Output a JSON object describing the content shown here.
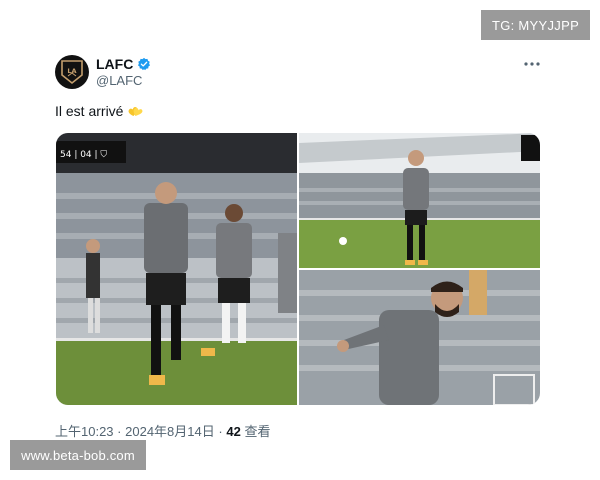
{
  "watermarks": {
    "top": "TG: MYYJJPP",
    "bottom": "www.beta-bob.com"
  },
  "tweet": {
    "display_name": "LAFC",
    "handle": "@LAFC",
    "verified": true,
    "text": "Il est arrivé",
    "emoji": "yellow-hearts-emoji",
    "time": "上午10:23",
    "separator": "·",
    "date": "2024年8月14日",
    "views_count": "42",
    "views_label": "查看",
    "media": [
      {
        "alt": "Player in grey training kit walking on pitch with teammates"
      },
      {
        "alt": "Player standing on pitch in empty stadium"
      },
      {
        "alt": "Close-up of player pointing during warmup"
      }
    ]
  },
  "colors": {
    "text_primary": "#0f1419",
    "text_secondary": "#536471",
    "verified_blue": "#1d9bf0",
    "watermark_bg": "#9a9a9a"
  },
  "icons": {
    "avatar": "lafc-logo-icon",
    "verified": "verified-badge-icon",
    "more": "more-options-icon"
  }
}
